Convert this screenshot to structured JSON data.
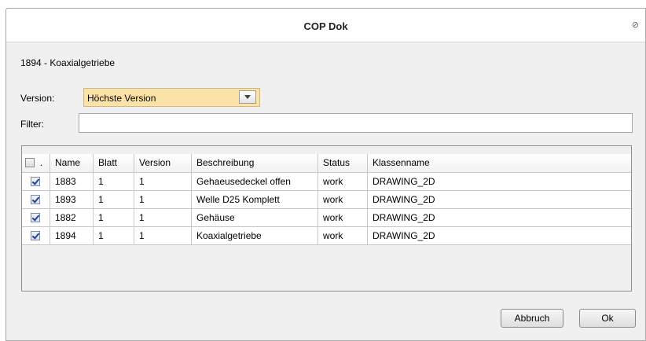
{
  "window": {
    "title": "COP Dok",
    "close_glyph": "⊘"
  },
  "document": {
    "label": "1894 - Koaxialgetriebe"
  },
  "version": {
    "label": "Version:",
    "selected": "Höchste Version"
  },
  "filter": {
    "label": "Filter:",
    "value": "",
    "placeholder": ""
  },
  "table": {
    "columns": [
      "",
      "Name",
      "Blatt",
      "Version",
      "Beschreibung",
      "Status",
      "Klassenname"
    ],
    "header_checkbox_checked": false,
    "rows": [
      {
        "checked": true,
        "name": "1883",
        "blatt": "1",
        "version": "1",
        "beschreibung": "Gehaeusedeckel offen",
        "status": "work",
        "klassenname": "DRAWING_2D"
      },
      {
        "checked": true,
        "name": "1893",
        "blatt": "1",
        "version": "1",
        "beschreibung": "Welle D25 Komplett",
        "status": "work",
        "klassenname": "DRAWING_2D"
      },
      {
        "checked": true,
        "name": "1882",
        "blatt": "1",
        "version": "1",
        "beschreibung": "Gehäuse",
        "status": "work",
        "klassenname": "DRAWING_2D"
      },
      {
        "checked": true,
        "name": "1894",
        "blatt": "1",
        "version": "1",
        "beschreibung": "Koaxialgetriebe",
        "status": "work",
        "klassenname": "DRAWING_2D"
      }
    ]
  },
  "buttons": {
    "cancel": "Abbruch",
    "ok": "Ok"
  },
  "colors": {
    "select_bg": "#fbe3a7",
    "dialog_bg": "#f0f0f0",
    "check_mark": "#2a3f8e"
  }
}
